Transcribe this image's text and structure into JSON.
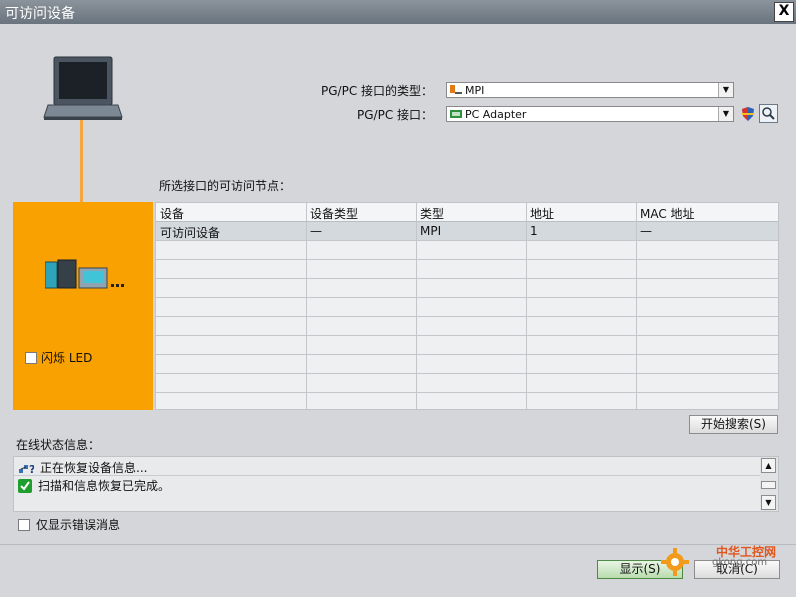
{
  "window": {
    "title": "可访问设备",
    "close_glyph": "X"
  },
  "form": {
    "interface_type_label": "PG/PC 接口的类型：",
    "interface_type_value": "MPI",
    "interface_label": "PG/PC 接口：",
    "interface_value": "PC Adapter"
  },
  "panel": {
    "flash_led_label": "闪烁 LED"
  },
  "nodes": {
    "section_label": "所选接口的可访问节点：",
    "columns": [
      "设备",
      "设备类型",
      "类型",
      "地址",
      "MAC 地址"
    ],
    "rows": [
      [
        "可访问设备",
        "—",
        "MPI",
        "1",
        "—"
      ]
    ]
  },
  "search_button": "开始搜索(S)",
  "status": {
    "label": "在线状态信息：",
    "messages": [
      {
        "icon": "network-query-icon",
        "text": "正在恢复设备信息..."
      },
      {
        "icon": "green-check-icon",
        "text": "扫描和信息恢复已完成。"
      }
    ]
  },
  "errors_only_label": "仅显示错误消息",
  "buttons": {
    "show": "显示(S)",
    "cancel": "取消(C)"
  },
  "watermark": {
    "line1": "中华工控网",
    "line2": "gkong.com"
  },
  "colors": {
    "orange": "#f9a100",
    "titlebar": "#7a838c",
    "check_green": "#1e9e2e"
  }
}
